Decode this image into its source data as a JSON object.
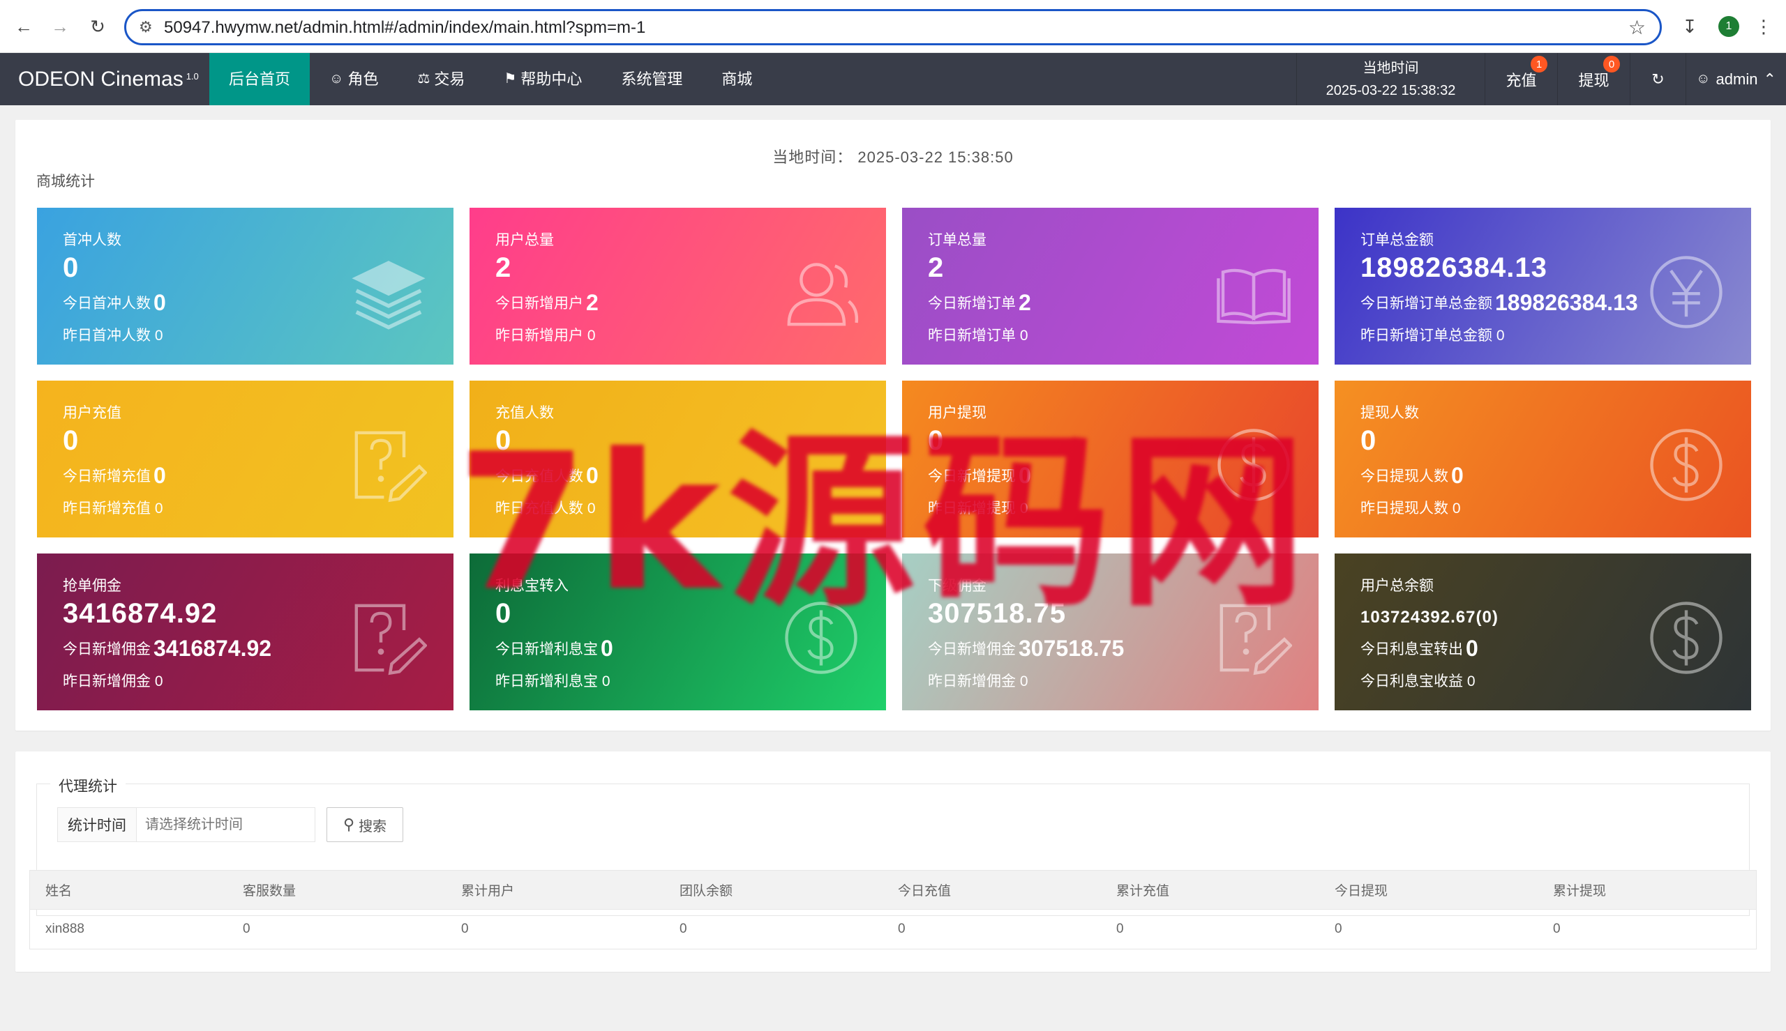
{
  "browser": {
    "url": "50947.hwymw.net/admin.html#/admin/index/main.html?spm=m-1",
    "profile_letter": "1"
  },
  "header": {
    "logo": "ODEON Cinemas",
    "logo_version": "1.0",
    "menu": [
      {
        "label": "后台首页",
        "icon": "",
        "active": true
      },
      {
        "label": "角色",
        "icon": "person-icon"
      },
      {
        "label": "交易",
        "icon": "scale-icon"
      },
      {
        "label": "帮助中心",
        "icon": "flag-icon"
      },
      {
        "label": "系统管理",
        "icon": ""
      },
      {
        "label": "商城",
        "icon": ""
      }
    ],
    "time_label": "当地时间",
    "time_value": "2025-03-22 15:38:32",
    "recharge_label": "充值",
    "recharge_badge": "1",
    "withdraw_label": "提现",
    "withdraw_badge": "0",
    "user": "admin"
  },
  "stats": {
    "local_time": "当地时间：  2025-03-22 15:38:50",
    "section_title": "商城统计",
    "cards": [
      {
        "title": "首冲人数",
        "value": "0",
        "line1_label": "今日首冲人数",
        "line1_value": "0",
        "line2": "昨日首冲人数 0",
        "icon": "layers-icon",
        "color": "#36a8d8"
      },
      {
        "title": "用户总量",
        "value": "2",
        "line1_label": "今日新增用户",
        "line1_value": "2",
        "line2": "昨日新增用户 0",
        "icon": "users-icon",
        "color": "#ff4a8a"
      },
      {
        "title": "订单总量",
        "value": "2",
        "line1_label": "今日新增订单",
        "line1_value": "2",
        "line2": "昨日新增订单 0",
        "icon": "book-icon",
        "color": "#b24ec9"
      },
      {
        "title": "订单总金额",
        "value": "189826384.13",
        "line1_label": "今日新增订单总金额",
        "line1_value": "189826384.13",
        "line2": "昨日新增订单总金额 0",
        "icon": "yen-icon",
        "color": "#4a3fc7"
      },
      {
        "title": "用户充值",
        "value": "0",
        "line1_label": "今日新增充值",
        "line1_value": "0",
        "line2": "昨日新增充值 0",
        "icon": "question-edit-icon",
        "color": "#f5b21f"
      },
      {
        "title": "充值人数",
        "value": "0",
        "line1_label": "今日充值人数",
        "line1_value": "0",
        "line2": "昨日充值人数 0",
        "icon": "edit-icon",
        "color": "#f1b81a"
      },
      {
        "title": "用户提现",
        "value": "0",
        "line1_label": "今日新增提现",
        "line1_value": "0",
        "line2": "昨日新增提现 0",
        "icon": "dollar-icon",
        "color": "#f06a28"
      },
      {
        "title": "提现人数",
        "value": "0",
        "line1_label": "今日提现人数",
        "line1_value": "0",
        "line2": "昨日提现人数 0",
        "icon": "dollar-icon",
        "color": "#f06a28"
      },
      {
        "title": "抢单佣金",
        "value": "3416874.92",
        "line1_label": "今日新增佣金",
        "line1_value": "3416874.92",
        "line2": "昨日新增佣金 0",
        "icon": "question-edit-icon",
        "color": "#8d1f52"
      },
      {
        "title": "利息宝转入",
        "value": "0",
        "line1_label": "今日新增利息宝",
        "line1_value": "0",
        "line2": "昨日新增利息宝 0",
        "icon": "dollar-icon",
        "color": "#17a550"
      },
      {
        "title": "下级佣金",
        "value": "307518.75",
        "line1_label": "今日新增佣金",
        "line1_value": "307518.75",
        "line2": "昨日新增佣金 0",
        "icon": "question-edit-icon",
        "color": "#c8a0a0"
      },
      {
        "title": "用户总余额",
        "value": "103724392.67(0)",
        "line1_label": "今日利息宝转出",
        "line1_value": "0",
        "line2": "今日利息宝收益 0",
        "icon": "dollar-icon",
        "color": "#3a3a2a"
      }
    ]
  },
  "watermark": "7k源码网",
  "agent": {
    "legend": "代理统计",
    "filter_label": "统计时间",
    "filter_placeholder": "请选择统计时间",
    "search_label": "搜索",
    "columns": [
      "姓名",
      "客服数量",
      "累计用户",
      "团队余额",
      "今日充值",
      "累计充值",
      "今日提现",
      "累计提现"
    ],
    "rows": [
      [
        "xin888",
        "0",
        "0",
        "0",
        "0",
        "0",
        "0",
        "0"
      ]
    ]
  }
}
